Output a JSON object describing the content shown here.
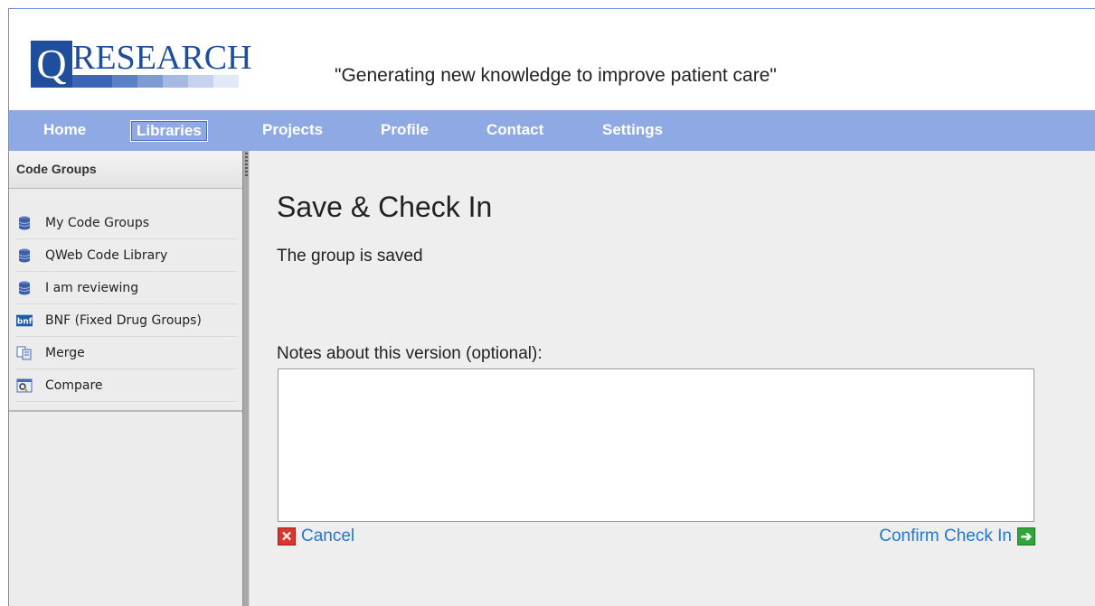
{
  "header": {
    "logo_letter": "Q",
    "logo_text": "RESEARCH",
    "tagline": "\"Generating new knowledge to improve patient care\""
  },
  "nav": {
    "items": [
      {
        "label": "Home"
      },
      {
        "label": "Libraries"
      },
      {
        "label": "Projects"
      },
      {
        "label": "Profile"
      },
      {
        "label": "Contact"
      },
      {
        "label": "Settings"
      }
    ],
    "active": "Libraries"
  },
  "sidebar": {
    "title": "Code Groups",
    "items": [
      {
        "label": "My Code Groups",
        "icon": "database-icon"
      },
      {
        "label": "QWeb Code Library",
        "icon": "database-icon"
      },
      {
        "label": "I am reviewing",
        "icon": "database-icon"
      },
      {
        "label": "BNF (Fixed Drug Groups)",
        "icon": "bnf-icon"
      },
      {
        "label": "Merge",
        "icon": "merge-icon"
      },
      {
        "label": "Compare",
        "icon": "compare-icon"
      }
    ]
  },
  "main": {
    "title": "Save & Check In",
    "saved_message": "The group is saved",
    "notes_label": "Notes about this version (optional):",
    "notes_value": "",
    "cancel_label": "Cancel",
    "confirm_label": "Confirm Check In"
  },
  "colors": {
    "brand_blue": "#1f4f9c",
    "nav_bg": "#8ea9e4",
    "link_blue": "#2477d1",
    "cancel_red": "#d9362e",
    "confirm_green": "#2fa63a"
  }
}
